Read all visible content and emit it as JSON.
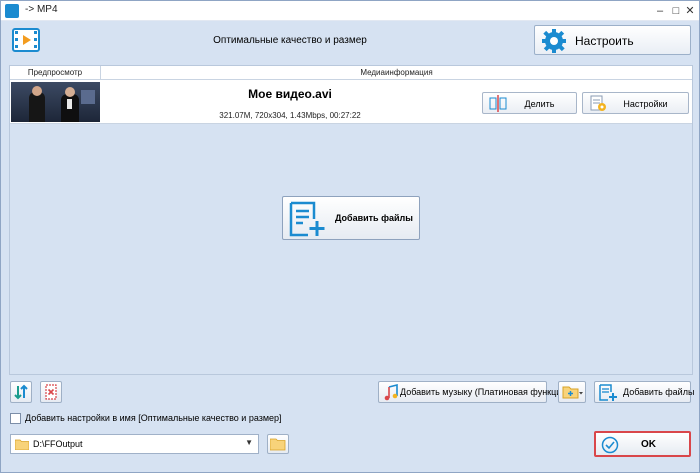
{
  "window": {
    "title": "-> MP4"
  },
  "header": {
    "title": "Оптимальные качество и размер",
    "configure_label": "Настроить"
  },
  "table": {
    "columns": {
      "preview": "Предпросмотр",
      "media": "Медиаинформация"
    },
    "file": {
      "name": "Мое видео.avi",
      "info": "321.07M, 720x304, 1.43Mbps, 00:27:22",
      "split_label": "Делить",
      "settings_label": "Настройки"
    }
  },
  "center": {
    "add_files_label": "Добавить файлы"
  },
  "toolbar": {
    "add_music_label": "Добавить музыку (Платиновая функция)",
    "add_files_label": "Добавить файлы"
  },
  "options": {
    "add_settings_to_name": "Добавить настройки в имя [Оптимальные качество и размер]"
  },
  "output": {
    "path": "D:\\FFOutput"
  },
  "ok_label": "OK",
  "colors": {
    "accent": "#1b8bd0",
    "ok_border": "#d9464a",
    "background": "#d6e2f2"
  }
}
